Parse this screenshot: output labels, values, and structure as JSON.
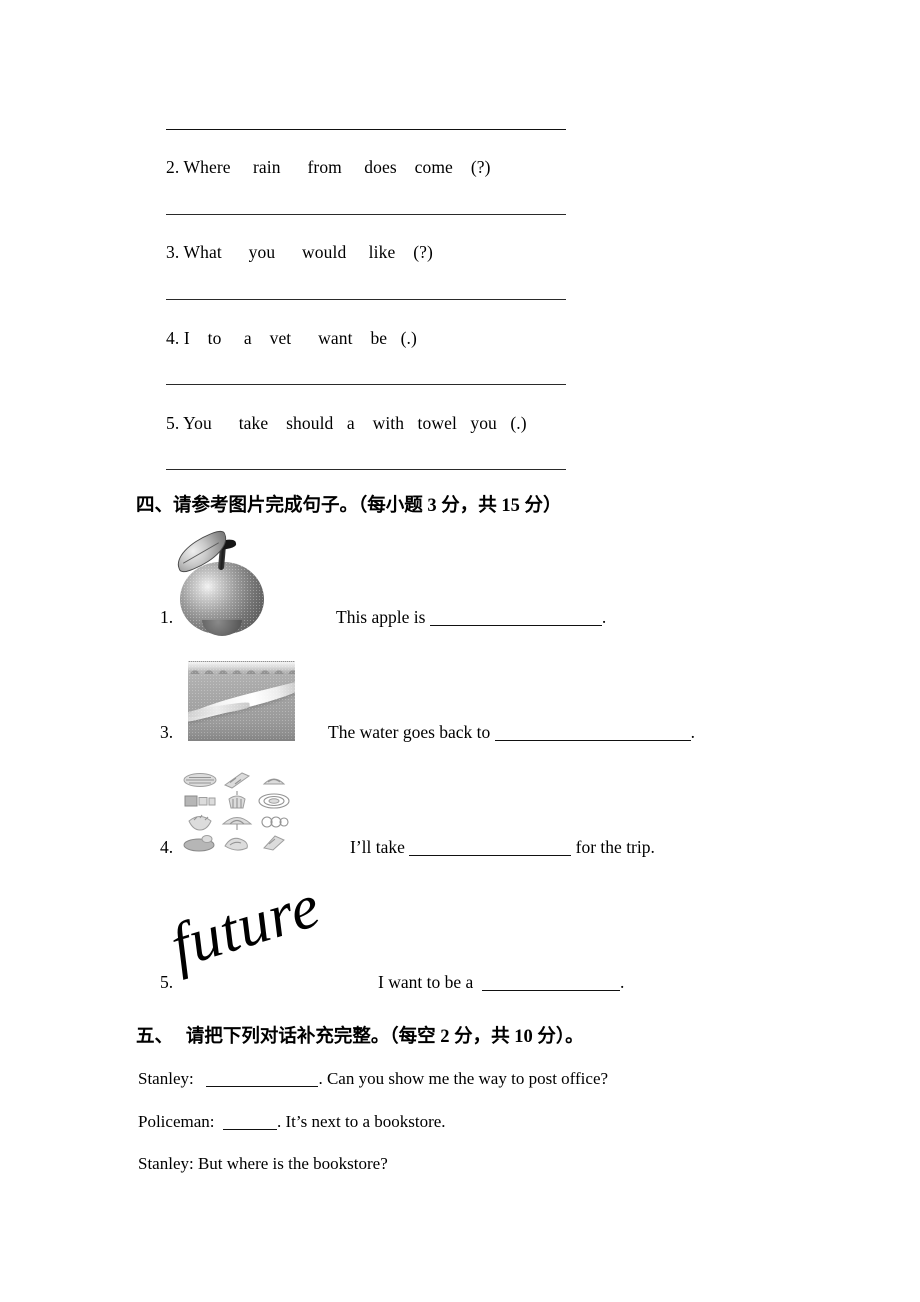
{
  "document": {
    "type": "english-exam-worksheet",
    "page_background": "#ffffff",
    "text_color": "#000000"
  },
  "section_three_continued": {
    "items": [
      {
        "number": "2.",
        "words": "Where     rain      from     does    come    (?)"
      },
      {
        "number": "3.",
        "words": "What      you      would     like    (?)"
      },
      {
        "number": "4.",
        "words": "I    to     a    vet      want    be   (.)"
      },
      {
        "number": "5.",
        "words": "You      take    should   a    with   towel   you   (.)"
      }
    ]
  },
  "section_four": {
    "heading_cn": "四、请参考图片完成句子。",
    "heading_score": "（每小题 3 分，共 15 分）",
    "questions": [
      {
        "number": "1.",
        "image": "apple-illustration",
        "text_before": "This apple is ",
        "text_after": "."
      },
      {
        "number": "3.",
        "image": "river-photo",
        "text_before": "The water goes back to ",
        "text_after": "."
      },
      {
        "number": "4.",
        "image": "picnic-items-grid",
        "text_before": "I’ll take ",
        "text_after": " for the trip."
      },
      {
        "number": "5.",
        "image": "future-word-art",
        "image_text": "future",
        "text_before": "I want to be a ",
        "text_after": "."
      }
    ]
  },
  "section_five": {
    "heading_cn": "五、  请把下列对话补充完整。",
    "heading_score": "（每空 2 分，共 10 分）。",
    "dialogue": [
      {
        "speaker": "Stanley:",
        "before_blank": "",
        "after_blank": ". Can you show me the way to post office?"
      },
      {
        "speaker": "Policeman:",
        "before_blank": "",
        "after_blank": ". It’s next to a bookstore."
      },
      {
        "speaker": "Stanley:",
        "before_blank": " But where is the bookstore?",
        "after_blank": ""
      }
    ]
  }
}
